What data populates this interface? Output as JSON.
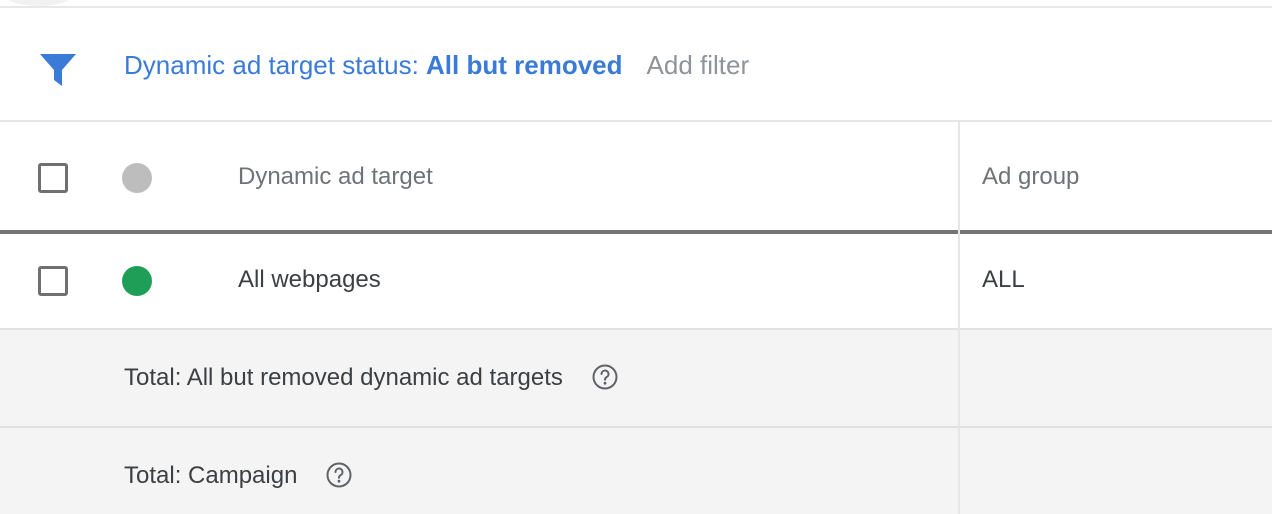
{
  "filter_bar": {
    "label": "Dynamic ad target status: ",
    "value": "All but removed",
    "add_filter": "Add filter",
    "icon": "filter-icon",
    "accent_color": "#3a7bd8"
  },
  "table": {
    "columns": {
      "target": "Dynamic ad target",
      "ad_group": "Ad group"
    },
    "header_status_color": "#bdbdbd",
    "rows": [
      {
        "target": "All webpages",
        "ad_group": "ALL",
        "status_color": "#1e9e57"
      }
    ],
    "totals": [
      {
        "label": "Total: All but removed dynamic ad targets",
        "icon": "help-icon"
      },
      {
        "label": "Total: Campaign",
        "icon": "help-icon"
      }
    ]
  }
}
